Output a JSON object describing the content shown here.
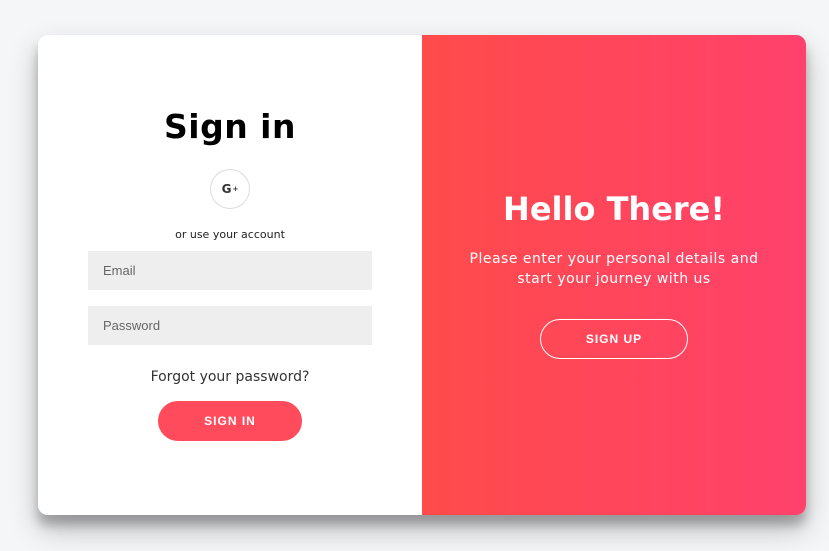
{
  "signin": {
    "title": "Sign in",
    "social_icon_label": "G",
    "social_icon_suffix": "+",
    "alt_text": "or use your account",
    "email_placeholder": "Email",
    "password_placeholder": "Password",
    "forgot_label": "Forgot your password?",
    "button_label": "SIGN IN"
  },
  "overlay": {
    "title": "Hello There!",
    "text": "Please enter your personal details and start your journey with us",
    "button_label": "SIGN UP"
  },
  "colors": {
    "accent": "#ff4b5b",
    "gradient_start": "#ff4b4b",
    "gradient_end": "#ff416c",
    "input_bg": "#eeeeee"
  }
}
